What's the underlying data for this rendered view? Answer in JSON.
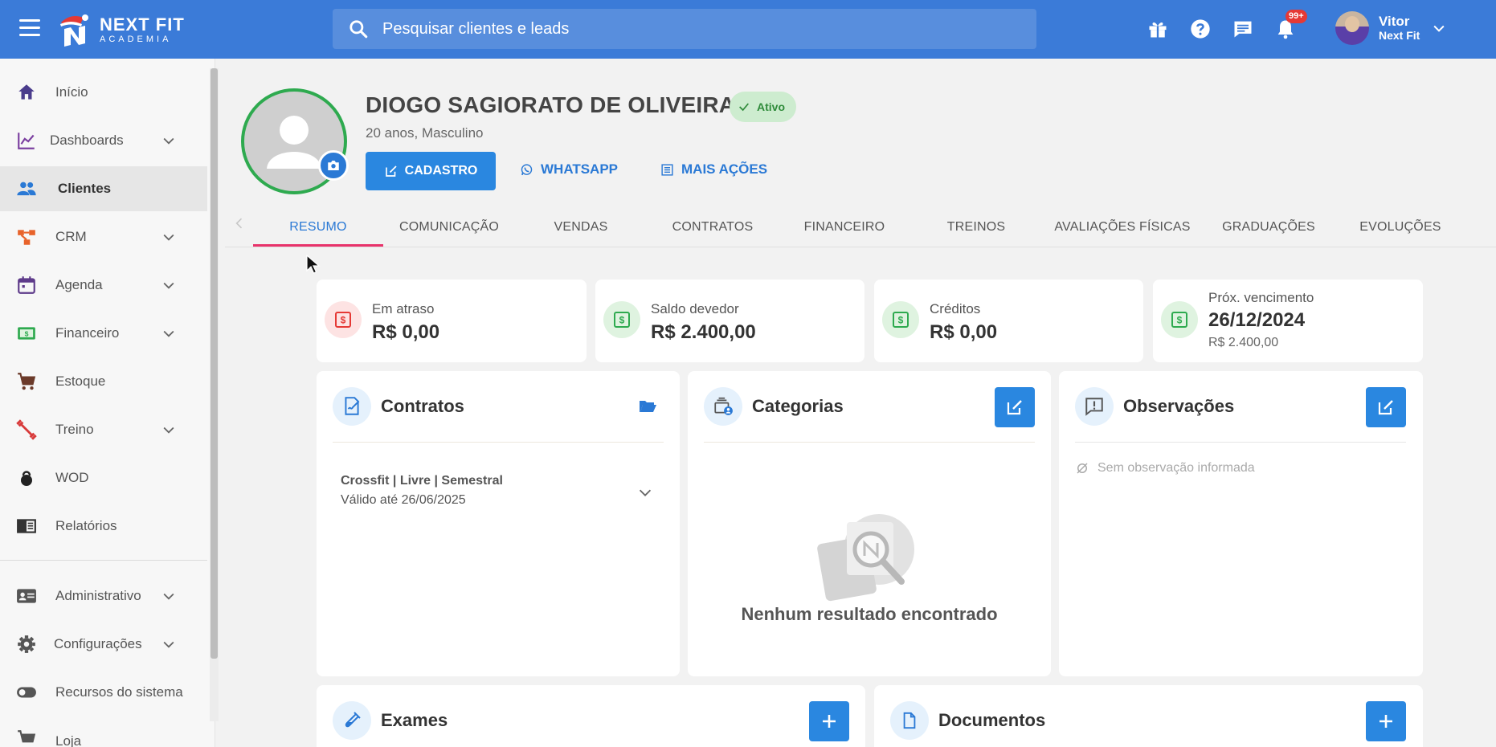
{
  "header": {
    "logo_line1": "NEXT FIT",
    "logo_line2": "ACADEMIA",
    "search_placeholder": "Pesquisar clientes e leads",
    "notifications_badge": "99+",
    "user_name": "Vitor",
    "user_company": "Next Fit"
  },
  "sidebar": {
    "items": [
      {
        "label": "Início",
        "icon": "home-icon",
        "color": "#4a3c8c"
      },
      {
        "label": "Dashboards",
        "icon": "chart-line-icon",
        "color": "#7b3fa0"
      },
      {
        "label": "Clientes",
        "icon": "people-icon",
        "color": "#2a79d5"
      },
      {
        "label": "CRM",
        "icon": "crm-icon",
        "color": "#e8632b"
      },
      {
        "label": "Agenda",
        "icon": "calendar-icon",
        "color": "#5e3b8a"
      },
      {
        "label": "Financeiro",
        "icon": "money-icon",
        "color": "#2eaa4f"
      },
      {
        "label": "Estoque",
        "icon": "cart-icon",
        "color": "#6b3a2a"
      },
      {
        "label": "Treino",
        "icon": "dumbbell-icon",
        "color": "#d83a3a"
      },
      {
        "label": "WOD",
        "icon": "kettlebell-icon",
        "color": "#222222"
      },
      {
        "label": "Relatórios",
        "icon": "report-icon",
        "color": "#333333"
      },
      {
        "label": "Administrativo",
        "icon": "id-card-icon",
        "color": "#555555"
      },
      {
        "label": "Configurações",
        "icon": "gear-icon",
        "color": "#555555"
      },
      {
        "label": "Recursos do sistema",
        "icon": "toggle-icon",
        "color": "#555555"
      },
      {
        "label": "Loja",
        "icon": "store-cart-icon",
        "color": "#555555"
      }
    ]
  },
  "profile": {
    "name": "DIOGO SAGIORATO DE OLIVEIRA",
    "status": "Ativo",
    "subtitle": "20 anos, Masculino",
    "btn_cadastro": "CADASTRO",
    "btn_whatsapp": "WHATSAPP",
    "btn_mais_acoes": "MAIS AÇÕES"
  },
  "tabs": [
    "RESUMO",
    "COMUNICAÇÃO",
    "VENDAS",
    "CONTRATOS",
    "FINANCEIRO",
    "TREINOS",
    "AVALIAÇÕES FÍSICAS",
    "GRADUAÇÕES",
    "EVOLUÇÕES"
  ],
  "stats": [
    {
      "label": "Em atraso",
      "value": "R$ 0,00"
    },
    {
      "label": "Saldo devedor",
      "value": "R$ 2.400,00"
    },
    {
      "label": "Créditos",
      "value": "R$ 0,00"
    },
    {
      "label": "Próx. vencimento",
      "value": "26/12/2024",
      "extra": "R$ 2.400,00"
    }
  ],
  "contratos": {
    "title": "Contratos",
    "item_name": "Crossfit | Livre | Semestral",
    "item_valid": "Válido até 26/06/2025"
  },
  "categorias": {
    "title": "Categorias",
    "empty": "Nenhum resultado encontrado"
  },
  "observacoes": {
    "title": "Observações",
    "empty": "Sem observação informada"
  },
  "exames": {
    "title": "Exames"
  },
  "documentos": {
    "title": "Documentos"
  },
  "colors": {
    "primary": "#2a87e0",
    "topbar": "#3b7bd8",
    "active_tab_underline": "#e8336b",
    "status_green": "#2eaa4f"
  }
}
